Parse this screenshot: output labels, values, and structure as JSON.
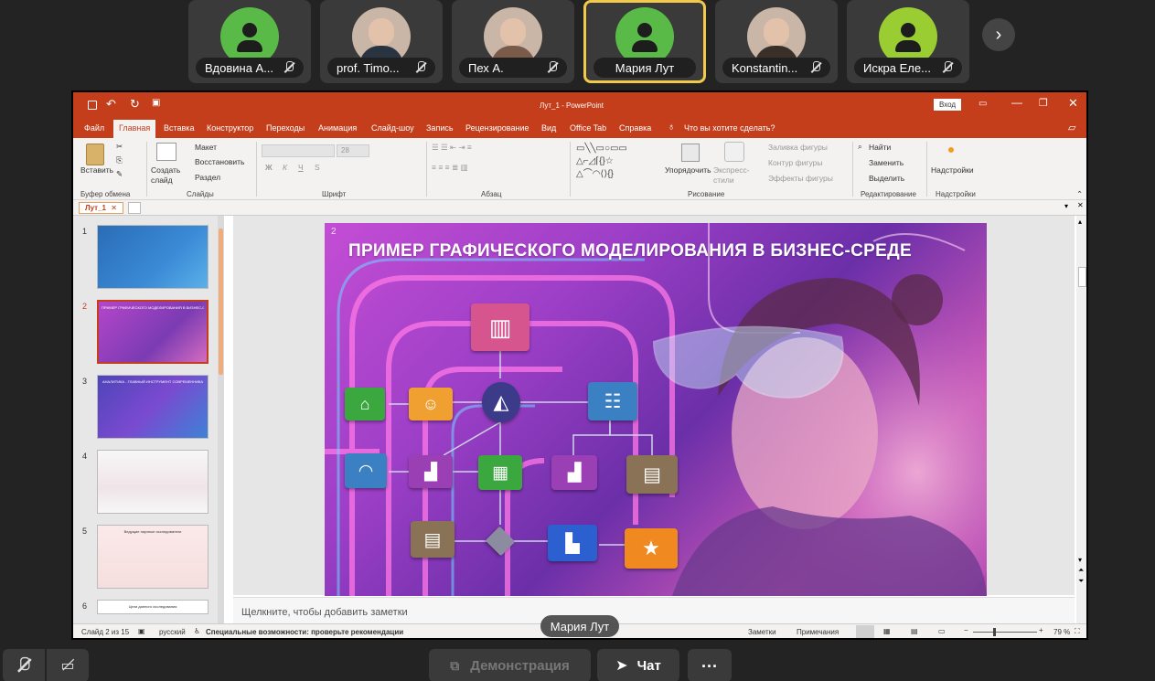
{
  "participants": [
    {
      "name": "Вдовина А...",
      "color": "#5aba47",
      "photo": false,
      "muted": true,
      "active": false
    },
    {
      "name": "prof. Timo...",
      "color": "#2a3340",
      "photo": true,
      "muted": true,
      "active": false
    },
    {
      "name": "Пех А.",
      "color": "#7a5a48",
      "photo": true,
      "muted": true,
      "active": false
    },
    {
      "name": "Мария Лут",
      "color": "#5aba47",
      "photo": false,
      "muted": false,
      "active": true
    },
    {
      "name": "Konstantin...",
      "color": "#3a3028",
      "photo": true,
      "muted": true,
      "active": false
    },
    {
      "name": "Искра Еле...",
      "color": "#9acd32",
      "photo": false,
      "muted": true,
      "active": false
    }
  ],
  "ppt": {
    "title": "Лут_1  -  PowerPoint",
    "login": "Вход",
    "menu": [
      "Файл",
      "Главная",
      "Вставка",
      "Конструктор",
      "Переходы",
      "Анимация",
      "Слайд-шоу",
      "Запись",
      "Рецензирование",
      "Вид",
      "Office Tab",
      "Справка"
    ],
    "search": "Что вы хотите сделать?",
    "ribbon": {
      "paste": "Вставить",
      "new_slide": "Создать слайд",
      "layout": "Макет",
      "reset": "Восстановить",
      "section": "Раздел",
      "font_size": "28",
      "arrange": "Упорядочить",
      "quick_styles": "Экспресс-стили",
      "shape_fill": "Заливка фигуры",
      "shape_outline": "Контур фигуры",
      "shape_effects": "Эффекты фигуры",
      "find": "Найти",
      "replace": "Заменить",
      "select": "Выделить",
      "addins": "Надстройки",
      "groups": [
        "Буфер обмена",
        "Слайды",
        "Шрифт",
        "Абзац",
        "Рисование",
        "Редактирование",
        "Надстройки"
      ],
      "font_buttons": [
        "Ж",
        "К",
        "Ч",
        "S"
      ]
    },
    "doc_tab": "Лут_1",
    "thumbs": [
      "1",
      "2",
      "3",
      "4",
      "5",
      "6"
    ],
    "thumb2_title": "ПРИМЕР ГРАФИЧЕСКОГО МОДЕЛИРОВАНИЯ В БИЗНЕС-СРЕДЕ",
    "thumb3_title": "АНАЛИТИКА - ГЛАВНЫЙ ИНСТРУМЕНТ СОВРЕМЕННИКА",
    "thumb5_title": "Ведущие научные исследователи",
    "thumb6_title": "Цели данного исследования",
    "slide": {
      "number": "2",
      "title": "ПРИМЕР ГРАФИЧЕСКОГО МОДЕЛИРОВАНИЯ В БИЗНЕС-СРЕДЕ",
      "nodes": [
        {
          "name": "hq-building",
          "color": "#d7558e",
          "glyph": "▥"
        },
        {
          "name": "bank",
          "color": "#3aa83f",
          "glyph": "⌂"
        },
        {
          "name": "person",
          "color": "#f0a030",
          "glyph": "☺"
        },
        {
          "name": "logo",
          "color": "#3b3b8a",
          "glyph": "◭"
        },
        {
          "name": "team",
          "color": "#3c80c4",
          "glyph": "☷"
        },
        {
          "name": "hangar",
          "color": "#3c80c4",
          "glyph": "◠"
        },
        {
          "name": "factory-1",
          "color": "#9b3fb5",
          "glyph": "▟"
        },
        {
          "name": "office-green",
          "color": "#3aa83f",
          "glyph": "▦"
        },
        {
          "name": "factory-2",
          "color": "#9b3fb5",
          "glyph": "▟"
        },
        {
          "name": "warehouse-1",
          "color": "#8a7256",
          "glyph": "▤"
        },
        {
          "name": "warehouse-2",
          "color": "#8a7256",
          "glyph": "▤"
        },
        {
          "name": "diamond",
          "color": "#8c8ca0",
          "glyph": "◆"
        },
        {
          "name": "plant-blue",
          "color": "#2c5fd0",
          "glyph": "▙"
        },
        {
          "name": "star",
          "color": "#f08a20",
          "glyph": "★"
        }
      ]
    },
    "notes": "Щелкните, чтобы добавить заметки",
    "status": {
      "slide": "Слайд 2 из 15",
      "lang": "русский",
      "accessibility": "Специальные возможности: проверьте рекомендации",
      "notes_btn": "Заметки",
      "comments_btn": "Примечания",
      "zoom": "79 %"
    }
  },
  "speaker_tag": "Мария Лут",
  "bottom": {
    "demo": "Демонстрация",
    "chat": "Чат",
    "more": "..."
  }
}
